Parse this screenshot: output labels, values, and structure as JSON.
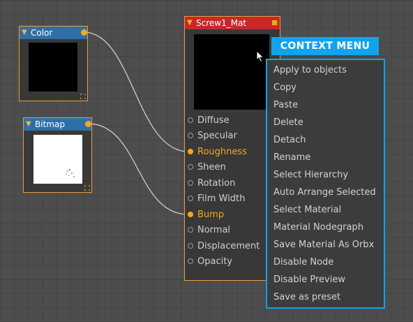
{
  "nodes": {
    "color": {
      "title": "Color"
    },
    "bitmap": {
      "title": "Bitmap"
    },
    "material": {
      "title": "Screw1_Mat",
      "pins": [
        {
          "label": "Diffuse",
          "connected": false
        },
        {
          "label": "Specular",
          "connected": false
        },
        {
          "label": "Roughness",
          "connected": true
        },
        {
          "label": "Sheen",
          "connected": false
        },
        {
          "label": "Rotation",
          "connected": false
        },
        {
          "label": "Film Width",
          "connected": false
        },
        {
          "label": "Bump",
          "connected": true
        },
        {
          "label": "Normal",
          "connected": false
        },
        {
          "label": "Displacement",
          "connected": false
        },
        {
          "label": "Opacity",
          "connected": false
        }
      ]
    }
  },
  "context_menu": {
    "title": "CONTEXT MENU",
    "items": [
      "Apply to objects",
      "Copy",
      "Paste",
      "Delete",
      "Detach",
      "Rename",
      "Select Hierarchy",
      "Auto Arrange Selected",
      "Select Material",
      "Material Nodegraph",
      "Save Material As Orbx",
      "Disable Node",
      "Disable Preview",
      "Save as preset"
    ]
  },
  "colors": {
    "grid_background": "#4d4d4d",
    "node_border": "#e8a03a",
    "pin_active": "#f5a623",
    "header_blue": "#2e6fa8",
    "header_red": "#c8282a",
    "menu_accent": "#10a4ee"
  },
  "icons": {
    "collapse": "triangle-down-icon",
    "output": "output-dot-icon",
    "resize": "resize-grip-icon",
    "cursor": "mouse-pointer-icon"
  }
}
